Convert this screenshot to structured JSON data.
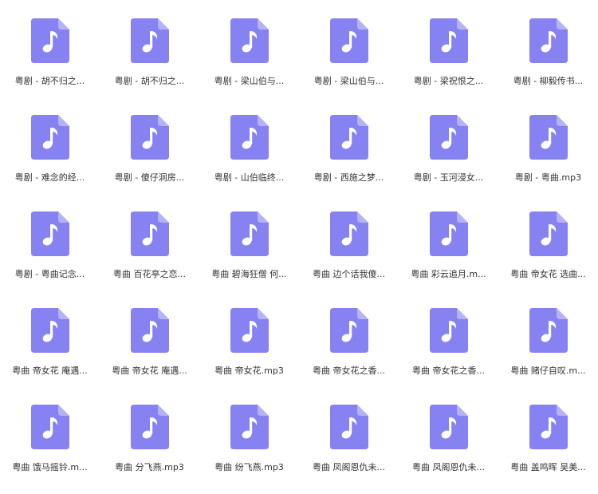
{
  "icon": {
    "name": "music-file-icon",
    "body_color": "#8682f2",
    "fold_color": "#b5b2f7",
    "glyph_color": "#ffffff"
  },
  "files": [
    {
      "name": "粤剧 - 胡不归之..."
    },
    {
      "name": "粤剧 - 胡不归之..."
    },
    {
      "name": "粤剧 - 梁山伯与..."
    },
    {
      "name": "粤剧 - 梁山伯与..."
    },
    {
      "name": "粤剧 - 梁祝恨之..."
    },
    {
      "name": "粤剧 - 柳毅传书..."
    },
    {
      "name": "粤剧 - 难念的经..."
    },
    {
      "name": "粤剧 - 傻仔洞房..."
    },
    {
      "name": "粤剧 - 山伯临终..."
    },
    {
      "name": "粤剧 - 西施之梦..."
    },
    {
      "name": "粤剧 - 玉河浸女..."
    },
    {
      "name": "粤剧 - 粤曲.mp3"
    },
    {
      "name": "粤剧 - 粤曲记念..."
    },
    {
      "name": "粤曲 百花亭之恋..."
    },
    {
      "name": "粤曲 碧海狂僧 何..."
    },
    {
      "name": "粤曲 边个话我傻..."
    },
    {
      "name": "粤曲 彩云追月.m..."
    },
    {
      "name": "粤曲 帝女花 选曲..."
    },
    {
      "name": "粤曲 帝女花 庵遇..."
    },
    {
      "name": "粤曲 帝女花 庵遇..."
    },
    {
      "name": "粤曲 帝女花.mp3"
    },
    {
      "name": "粤曲 帝女花之香..."
    },
    {
      "name": "粤曲 帝女花之香..."
    },
    {
      "name": "粤曲 赌仔自叹.m..."
    },
    {
      "name": "粤曲 饿马摇铃.m..."
    },
    {
      "name": "粤曲 分飞燕.mp3"
    },
    {
      "name": "粤曲 纷飞燕.mp3"
    },
    {
      "name": "粤曲 凤阁恩仇未..."
    },
    {
      "name": "粤曲 凤阁恩仇未..."
    },
    {
      "name": "粤曲 盖鸣晖 吴美..."
    }
  ]
}
